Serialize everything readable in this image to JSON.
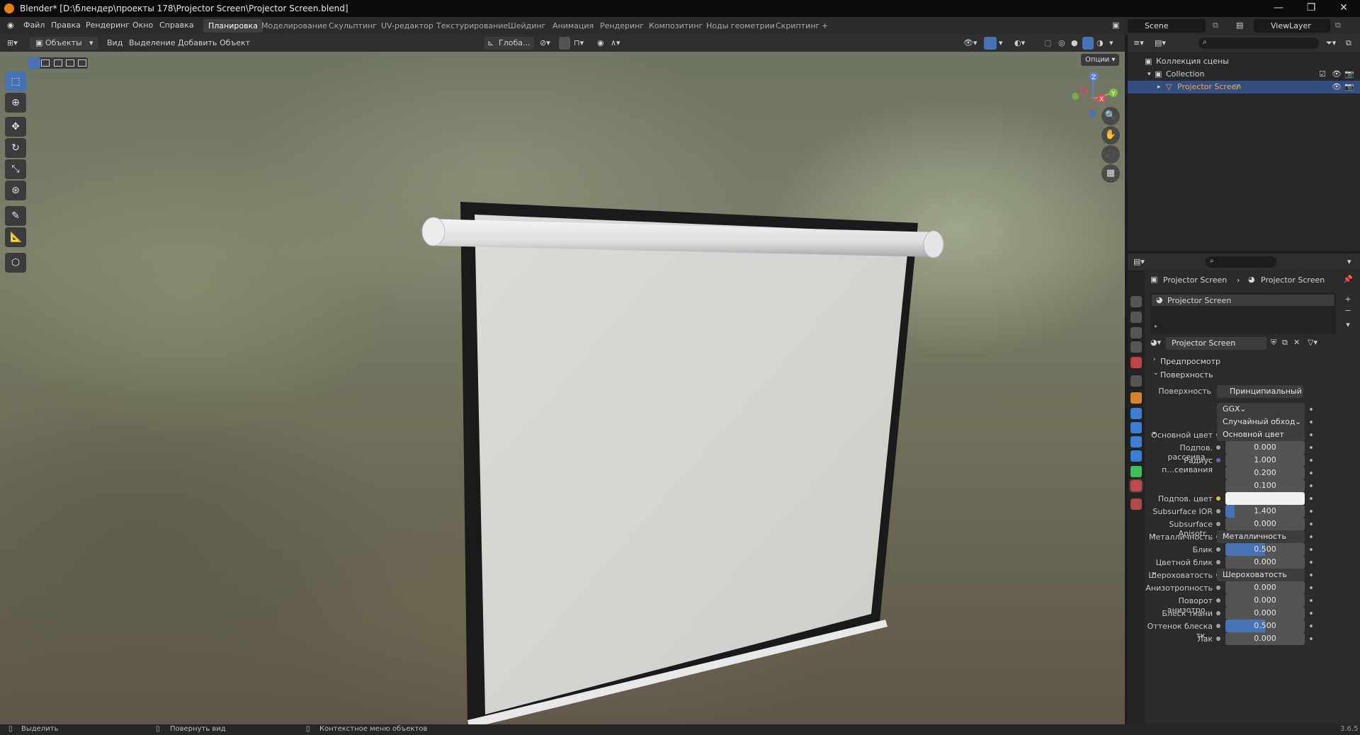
{
  "window": {
    "title": "Blender* [D:\\блендер\\проекты 178\\Projector Screen\\Projector Screen.blend]",
    "controls": [
      "—",
      "❐",
      "✕"
    ]
  },
  "menu": [
    "Файл",
    "Правка",
    "Рендеринг",
    "Окно",
    "Справка"
  ],
  "workspaces": [
    "Планировка",
    "Моделирование",
    "Скульптинг",
    "UV-редактор",
    "Текстурирование",
    "Шейдинг",
    "Анимация",
    "Рендеринг",
    "Композитинг",
    "Ноды геометрии",
    "Скриптинг",
    "+"
  ],
  "active_workspace_index": 0,
  "scene": {
    "name": "Scene",
    "view_layer": "ViewLayer"
  },
  "viewport_header": {
    "mode": "Объекты",
    "menus": [
      "Вид",
      "Выделение",
      "Добавить",
      "Объект"
    ],
    "orientation": "Глоба...",
    "options": "Опции"
  },
  "gizmo": {
    "x": "X",
    "y": "Y",
    "z": "Z"
  },
  "outliner": {
    "rows": [
      {
        "label": "Коллекция сцены"
      },
      {
        "label": "Collection"
      },
      {
        "label": "Projector Screen"
      }
    ]
  },
  "properties": {
    "breadcrumb_object": "Projector Screen",
    "breadcrumb_material": "Projector Screen",
    "slot_name": "Projector Screen",
    "material_name": "Projector Screen",
    "panels": {
      "preview": "Предпросмотр",
      "surface": "Поверхность"
    },
    "surface_label": "Поверхность",
    "surface_value": "Принципиальный BSDF",
    "distribution": "GGX",
    "subsurface_method": "Случайный обход",
    "rows": [
      {
        "label": "Основной цвет",
        "value": "Основной цвет",
        "kind": "link",
        "expand": "▸",
        "socket": "#c7c729"
      },
      {
        "label": "Подпов. рассеива...",
        "value": "0.000",
        "kind": "num",
        "fill": 0,
        "socket": "#a1a1a1"
      },
      {
        "label": "Радиус п...сеивания",
        "value": "1.000",
        "kind": "num",
        "fill": 0,
        "socket": "#6363c7"
      },
      {
        "label": "",
        "value": "0.200",
        "kind": "num",
        "fill": 0
      },
      {
        "label": "",
        "value": "0.100",
        "kind": "num",
        "fill": 0
      },
      {
        "label": "Подпов. цвет",
        "value": "",
        "kind": "color",
        "color": "#f0f0f0",
        "socket": "#c7c729"
      },
      {
        "label": "Subsurface IOR",
        "value": "1.400",
        "kind": "num",
        "fill": 0.12,
        "socket": "#a1a1a1"
      },
      {
        "label": "Subsurface Anisotr...",
        "value": "0.000",
        "kind": "num",
        "fill": 0,
        "socket": "#a1a1a1"
      },
      {
        "label": "Металличность",
        "value": "Металличность",
        "kind": "link",
        "expand": "▸",
        "socket": "#a1a1a1"
      },
      {
        "label": "Блик",
        "value": "0.500",
        "kind": "num",
        "fill": 0.5,
        "socket": "#a1a1a1"
      },
      {
        "label": "Цветной блик",
        "value": "0.000",
        "kind": "num",
        "fill": 0,
        "socket": "#a1a1a1"
      },
      {
        "label": "Шероховатость",
        "value": "Шероховатость",
        "kind": "link",
        "expand": "▸",
        "socket": "#a1a1a1"
      },
      {
        "label": "Анизотропность",
        "value": "0.000",
        "kind": "num",
        "fill": 0,
        "socket": "#a1a1a1"
      },
      {
        "label": "Поворот анизотро...",
        "value": "0.000",
        "kind": "num",
        "fill": 0,
        "socket": "#a1a1a1"
      },
      {
        "label": "Блеск ткани",
        "value": "0.000",
        "kind": "num",
        "fill": 0,
        "socket": "#a1a1a1"
      },
      {
        "label": "Оттенок блеска тк...",
        "value": "0.500",
        "kind": "num",
        "fill": 0.5,
        "socket": "#a1a1a1"
      },
      {
        "label": "Лак",
        "value": "0.000",
        "kind": "num",
        "fill": 0,
        "socket": "#a1a1a1"
      }
    ]
  },
  "statusbar": {
    "select": "Выделить",
    "rotate": "Повернуть вид",
    "context": "Контекстное меню объектов",
    "version": "3.6.5"
  },
  "colors": {
    "accent": "#4772b3",
    "selection": "#334d80",
    "active_object_text": "#f2a54a"
  }
}
